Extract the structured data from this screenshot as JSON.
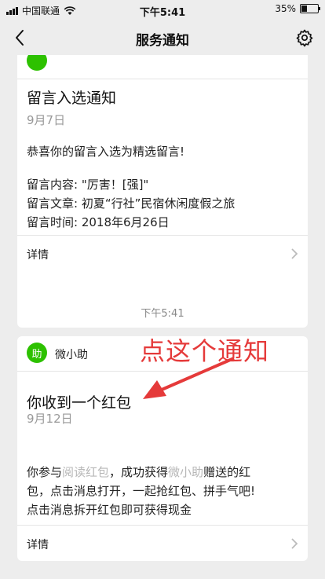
{
  "status_bar": {
    "carrier": "中国联通",
    "time": "下午5:41",
    "battery": "35%"
  },
  "nav": {
    "title": "服务通知"
  },
  "card1": {
    "title": "留言入选通知",
    "date": "9月7日",
    "message": "恭喜你的留言入选为精选留言!",
    "content_line": "留言内容: \"厉害！[强]\"",
    "article_line": "留言文章: 初夏“行社”民宿休闲度假之旅",
    "time_line": "留言时间: 2018年6月26日",
    "detail_label": "详情"
  },
  "separator_time": "下午5:41",
  "card2": {
    "app_icon_char": "助",
    "app_name": "微小助",
    "title": "你收到一个红包",
    "date": "9月12日",
    "body": {
      "p1": "你参与",
      "h1": "阅读红包",
      "p2": "，成功获得",
      "h2": "微小助",
      "p3": "赠送的红",
      "line2": "包，点击消息打开，一起抢红包、拼手气吧!",
      "line3": "点击消息拆开红包即可获得现金"
    },
    "detail_label": "详情"
  },
  "annotation": "点这个通知",
  "colors": {
    "background": "#ededed",
    "wechat_green": "#2dc100",
    "annotation_red": "#e53a3a"
  }
}
